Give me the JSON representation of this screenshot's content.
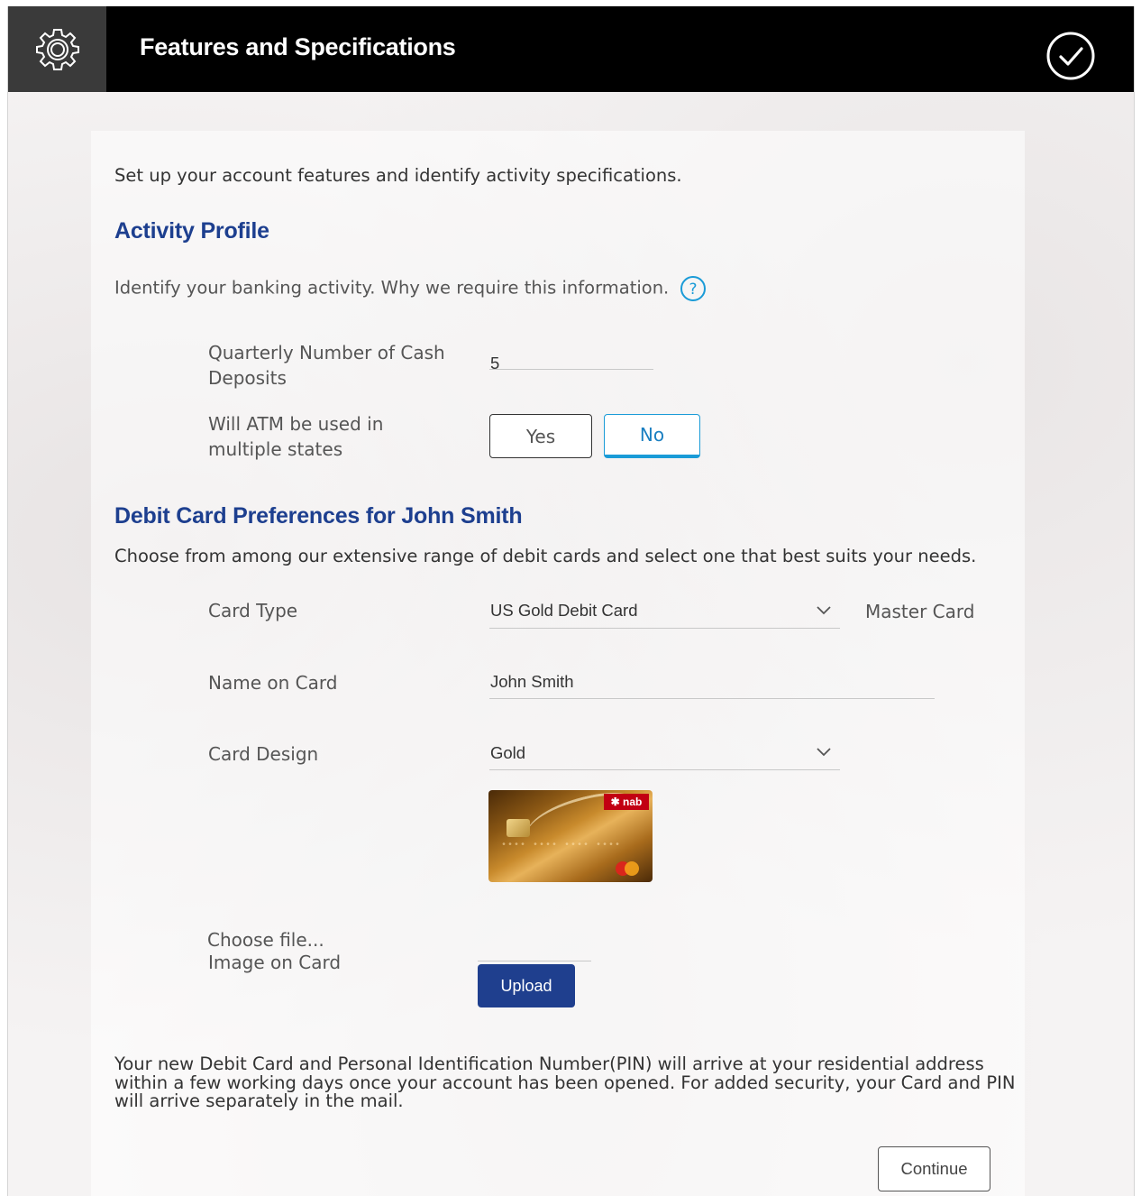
{
  "header": {
    "title": "Features and Specifications",
    "icons": {
      "left": "gear-icon",
      "right": "check-circle-icon"
    },
    "background": "#000000"
  },
  "intro": "Set up your account features and identify activity specifications.",
  "activity_profile": {
    "title": "Activity Profile",
    "subtitle": "Identify your banking activity. Why we require this information.",
    "help_icon": "question-circle-icon",
    "quarterly_label": "Quarterly Number of Cash Deposits",
    "quarterly_value": "5",
    "atm_label": "Will ATM be used in multiple states",
    "atm_yes": "Yes",
    "atm_no": "No",
    "atm_selected": "No"
  },
  "debit_card": {
    "title": "Debit Card Preferences for John Smith",
    "subtitle": "Choose from among our extensive range of debit cards and select one that best suits your needs.",
    "card_type_label": "Card Type",
    "card_type_value": "US Gold Debit Card",
    "card_network": "Master Card",
    "name_label": "Name on Card",
    "name_value": "John Smith",
    "design_label": "Card Design",
    "design_value": "Gold",
    "card_image": {
      "brand": "nab",
      "network_logo": "mastercard-logo",
      "color": "#c88a2c"
    },
    "image_label": "Image on Card",
    "choose_file": "Choose file...",
    "upload": "Upload"
  },
  "notice": "Your new Debit Card and Personal Identification Number(PIN) will arrive at your residential address within a few working days once your account has been opened. For added security, your Card and PIN will arrive separately in the mail.",
  "continue": "Continue",
  "colors": {
    "accent": "#1d3f8f",
    "active": "#1a9bd7",
    "upload_bg": "#1f3f8e"
  }
}
